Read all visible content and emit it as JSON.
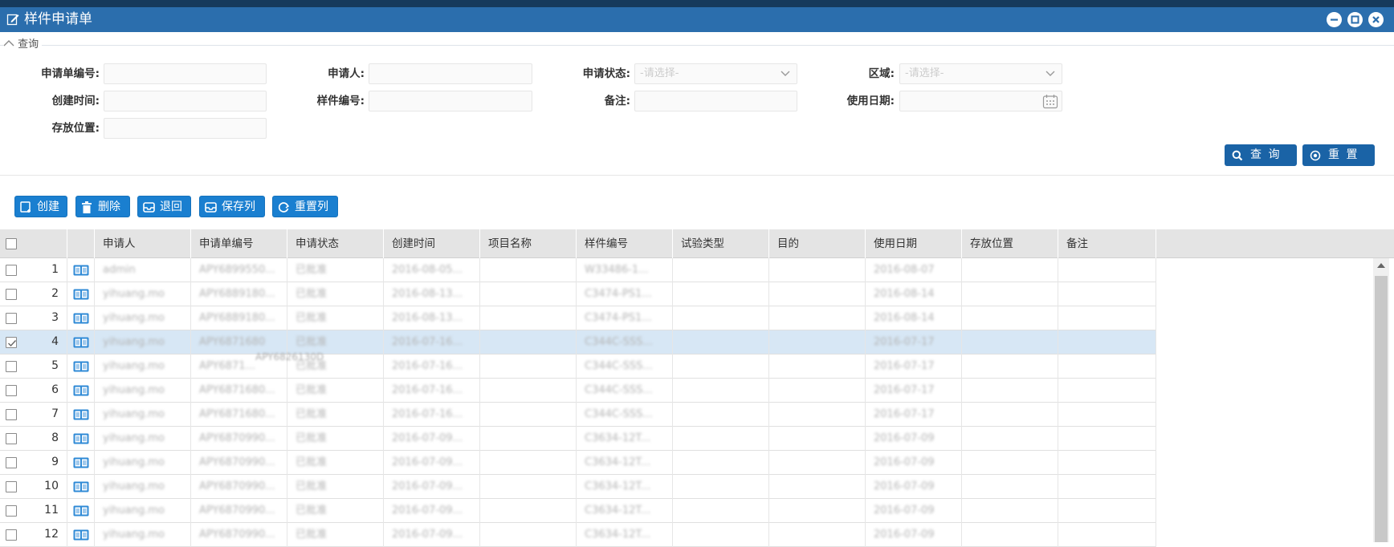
{
  "window": {
    "title": "样件申请单"
  },
  "query_section": {
    "legend": "查询"
  },
  "filters": {
    "app_no_label": "申请单编号:",
    "applicant_label": "申请人:",
    "status_label": "申请状态:",
    "status_placeholder": "-请选择-",
    "region_label": "区域:",
    "region_placeholder": "-请选择-",
    "created_label": "创建时间:",
    "sample_no_label": "样件编号:",
    "remark_label": "备注:",
    "use_date_label": "使用日期:",
    "location_label": "存放位置:"
  },
  "actions": {
    "search": "查 询",
    "reset": "重 置"
  },
  "toolbar": {
    "create": "创建",
    "delete": "删除",
    "return": "退回",
    "save_cols": "保存列",
    "reset_cols": "重置列"
  },
  "grid": {
    "headers": [
      "申请人",
      "申请单编号",
      "申请状态",
      "创建时间",
      "项目名称",
      "样件编号",
      "试验类型",
      "目的",
      "使用日期",
      "存放位置",
      "备注"
    ],
    "rows": [
      {
        "n": "1",
        "applicant": "admin",
        "no": "APY6899550...",
        "status": "已批准",
        "created": "2016-08-05...",
        "project": "",
        "sample": "W33486-1...",
        "test": "",
        "purpose": "",
        "date": "2016-08-07",
        "loc": "",
        "remark": ""
      },
      {
        "n": "2",
        "applicant": "yihuang.mo",
        "no": "APY6889180...",
        "status": "已批准",
        "created": "2016-08-13...",
        "project": "",
        "sample": "C3474-PS1...",
        "test": "",
        "purpose": "",
        "date": "2016-08-14",
        "loc": "",
        "remark": ""
      },
      {
        "n": "3",
        "applicant": "yihuang.mo",
        "no": "APY6889180...",
        "status": "已批准",
        "created": "2016-08-13...",
        "project": "",
        "sample": "C3474-PS1...",
        "test": "",
        "purpose": "",
        "date": "2016-08-14",
        "loc": "",
        "remark": ""
      },
      {
        "n": "4",
        "applicant": "yihuang.mo",
        "no": "APY6871680",
        "status": "已批准",
        "created": "2016-07-16...",
        "project": "",
        "sample": "C344C-SSS...",
        "test": "",
        "purpose": "",
        "date": "2016-07-17",
        "loc": "",
        "remark": ""
      },
      {
        "n": "5",
        "applicant": "yihuang.mo",
        "no": "APY6871...",
        "status": "已批准",
        "created": "2016-07-16...",
        "project": "",
        "sample": "C344C-SSS...",
        "test": "",
        "purpose": "",
        "date": "2016-07-17",
        "loc": "",
        "remark": ""
      },
      {
        "n": "6",
        "applicant": "yihuang.mo",
        "no": "APY6871680...",
        "status": "已批准",
        "created": "2016-07-16...",
        "project": "",
        "sample": "C344C-SSS...",
        "test": "",
        "purpose": "",
        "date": "2016-07-17",
        "loc": "",
        "remark": ""
      },
      {
        "n": "7",
        "applicant": "yihuang.mo",
        "no": "APY6871680...",
        "status": "已批准",
        "created": "2016-07-16...",
        "project": "",
        "sample": "C344C-SSS...",
        "test": "",
        "purpose": "",
        "date": "2016-07-17",
        "loc": "",
        "remark": ""
      },
      {
        "n": "8",
        "applicant": "yihuang.mo",
        "no": "APY6870990...",
        "status": "已批准",
        "created": "2016-07-09...",
        "project": "",
        "sample": "C3634-12T...",
        "test": "",
        "purpose": "",
        "date": "2016-07-09",
        "loc": "",
        "remark": ""
      },
      {
        "n": "9",
        "applicant": "yihuang.mo",
        "no": "APY6870990...",
        "status": "已批准",
        "created": "2016-07-09...",
        "project": "",
        "sample": "C3634-12T...",
        "test": "",
        "purpose": "",
        "date": "2016-07-09",
        "loc": "",
        "remark": ""
      },
      {
        "n": "10",
        "applicant": "yihuang.mo",
        "no": "APY6870990...",
        "status": "已批准",
        "created": "2016-07-09...",
        "project": "",
        "sample": "C3634-12T...",
        "test": "",
        "purpose": "",
        "date": "2016-07-09",
        "loc": "",
        "remark": ""
      },
      {
        "n": "11",
        "applicant": "yihuang.mo",
        "no": "APY6870990...",
        "status": "已批准",
        "created": "2016-07-09...",
        "project": "",
        "sample": "C3634-12T...",
        "test": "",
        "purpose": "",
        "date": "2016-07-09",
        "loc": "",
        "remark": ""
      },
      {
        "n": "12",
        "applicant": "yihuang.mo",
        "no": "APY6870990...",
        "status": "已批准",
        "created": "2016-07-09...",
        "project": "",
        "sample": "C3634-12T...",
        "test": "",
        "purpose": "",
        "date": "2016-07-09",
        "loc": "",
        "remark": ""
      }
    ],
    "selected_row": 4,
    "drag_ghost": "APY6826130D"
  },
  "colors": {
    "titlebar": "#2b6ead",
    "primary_button": "#1a63a6",
    "toolbar_button": "#1a7fd0",
    "selected_row": "#d7e7f5"
  }
}
